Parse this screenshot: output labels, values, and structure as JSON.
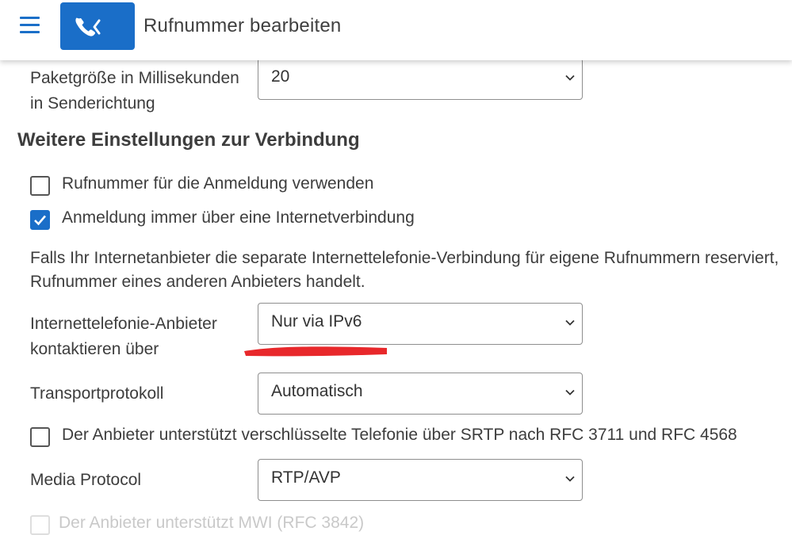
{
  "header": {
    "title": "Rufnummer bearbeiten"
  },
  "fields": {
    "packet_size": {
      "label_line1": "Paketgröße in Millisekunden",
      "label_line2": "in Senderichtung",
      "value": "20"
    },
    "contact_via": {
      "label_line1": "Internettelefonie-Anbieter",
      "label_line2": "kontaktieren über",
      "value": "Nur via IPv6"
    },
    "transport": {
      "label": "Transportprotokoll",
      "value": "Automatisch"
    },
    "media_protocol": {
      "label": "Media Protocol",
      "value": "RTP/AVP"
    }
  },
  "section": {
    "heading": "Weitere Einstellungen zur Verbindung"
  },
  "checkboxes": {
    "use_number_login": {
      "label": "Rufnummer für die Anmeldung verwenden",
      "checked": false
    },
    "always_internet": {
      "label": "Anmeldung immer über eine Internetverbindung",
      "checked": true
    },
    "srtp": {
      "label": "Der Anbieter unterstützt verschlüsselte Telefonie über SRTP nach RFC 3711 und RFC 4568",
      "checked": false
    },
    "mwi": {
      "label": "Der Anbieter unterstützt MWI (RFC 3842)",
      "checked": false
    }
  },
  "info": {
    "line1": "Falls Ihr Internetanbieter die separate Internettelefonie-Verbindung für eigene Rufnummern reserviert,",
    "line2": "Rufnummer eines anderen Anbieters handelt."
  },
  "colors": {
    "accent": "#1a6ec8",
    "annotation": "#e8282b"
  },
  "icons": {
    "menu": "hamburger-menu-icon",
    "phone": "phone-icon",
    "back": "chevron-left-icon",
    "dropdown": "chevron-down-icon",
    "check": "checkmark-icon"
  }
}
